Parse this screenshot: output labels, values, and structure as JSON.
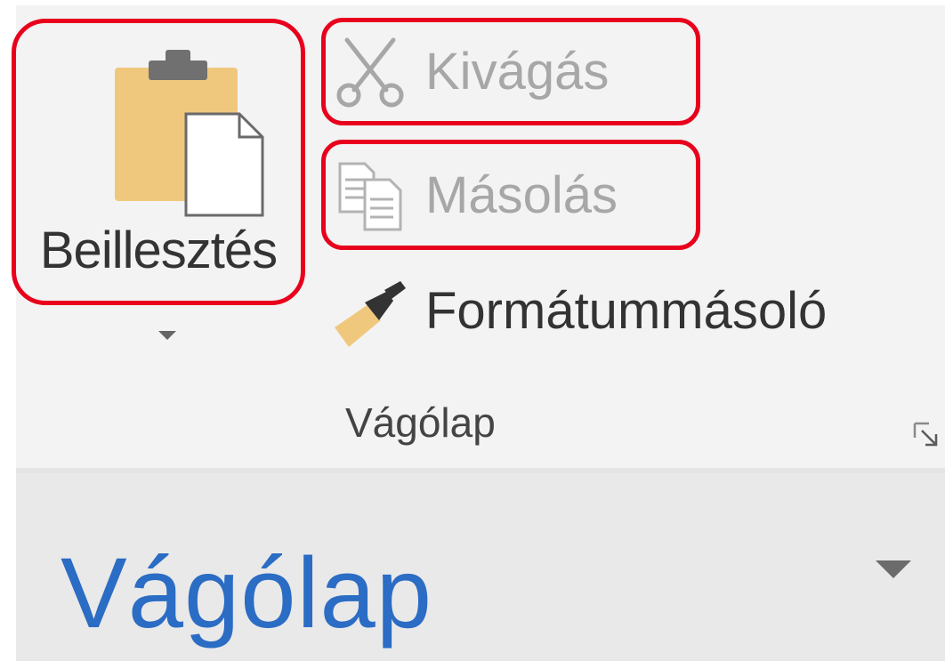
{
  "ribbon": {
    "paste": {
      "label": "Beillesztés",
      "icon": "clipboard-paste-icon"
    },
    "cut": {
      "label": "Kivágás",
      "icon": "scissors-icon"
    },
    "copy": {
      "label": "Másolás",
      "icon": "copy-icon"
    },
    "format_painter": {
      "label": "Formátummásoló",
      "icon": "paintbrush-icon"
    },
    "group_label": "Vágólap",
    "launcher_icon": "dialog-launcher-icon"
  },
  "clipboard_pane": {
    "title": "Vágólap",
    "dropdown_icon": "chevron-down-icon"
  },
  "colors": {
    "highlight_border": "#e8001c",
    "pane_title": "#2b6cc4",
    "clipboard_body": "#f0c87d",
    "clipboard_clip": "#707070",
    "disabled_text": "#a7a7a7",
    "enabled_text": "#333333"
  }
}
